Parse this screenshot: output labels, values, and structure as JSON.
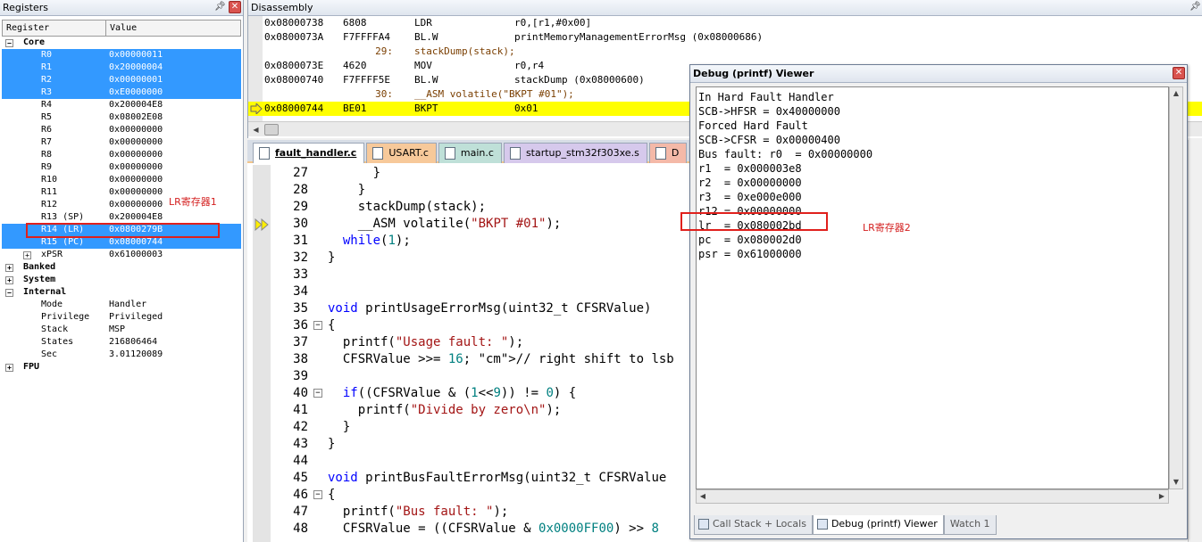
{
  "registers": {
    "title": "Registers",
    "col_register": "Register",
    "col_value": "Value",
    "rows": [
      {
        "name": "Core",
        "value": "",
        "type": "group",
        "expanded": true
      },
      {
        "name": "R0",
        "value": "0x00000011",
        "type": "reg",
        "selected": true
      },
      {
        "name": "R1",
        "value": "0x20000004",
        "type": "reg",
        "selected": true
      },
      {
        "name": "R2",
        "value": "0x00000001",
        "type": "reg",
        "selected": true
      },
      {
        "name": "R3",
        "value": "0xE0000000",
        "type": "reg",
        "selected": true
      },
      {
        "name": "R4",
        "value": "0x200004E8",
        "type": "reg"
      },
      {
        "name": "R5",
        "value": "0x08002E08",
        "type": "reg"
      },
      {
        "name": "R6",
        "value": "0x00000000",
        "type": "reg"
      },
      {
        "name": "R7",
        "value": "0x00000000",
        "type": "reg"
      },
      {
        "name": "R8",
        "value": "0x00000000",
        "type": "reg"
      },
      {
        "name": "R9",
        "value": "0x00000000",
        "type": "reg"
      },
      {
        "name": "R10",
        "value": "0x00000000",
        "type": "reg"
      },
      {
        "name": "R11",
        "value": "0x00000000",
        "type": "reg"
      },
      {
        "name": "R12",
        "value": "0x00000000",
        "type": "reg"
      },
      {
        "name": "R13 (SP)",
        "value": "0x200004E8",
        "type": "reg"
      },
      {
        "name": "R14 (LR)",
        "value": "0x0800279B",
        "type": "reg",
        "selected": true
      },
      {
        "name": "R15 (PC)",
        "value": "0x08000744",
        "type": "reg",
        "selected": true
      },
      {
        "name": "xPSR",
        "value": "0x61000003",
        "type": "reg",
        "expandable": true
      },
      {
        "name": "Banked",
        "value": "",
        "type": "group2"
      },
      {
        "name": "System",
        "value": "",
        "type": "group2"
      },
      {
        "name": "Internal",
        "value": "",
        "type": "group",
        "expanded": true
      },
      {
        "name": "Mode",
        "value": "Handler",
        "type": "reg"
      },
      {
        "name": "Privilege",
        "value": "Privileged",
        "type": "reg"
      },
      {
        "name": "Stack",
        "value": "MSP",
        "type": "reg"
      },
      {
        "name": "States",
        "value": "216806464",
        "type": "reg"
      },
      {
        "name": "Sec",
        "value": "3.01120089",
        "type": "reg"
      },
      {
        "name": "FPU",
        "value": "",
        "type": "group2"
      }
    ],
    "annotation": "LR寄存器1"
  },
  "disassembly": {
    "title": "Disassembly",
    "rows": [
      {
        "kind": "asm",
        "addr": "0x08000738",
        "hex": "6808",
        "mn": "LDR",
        "ops": "r0,[r1,#0x00]"
      },
      {
        "kind": "asm",
        "addr": "0x0800073A",
        "hex": "F7FFFFA4",
        "mn": "BL.W",
        "ops": "printMemoryManagementErrorMsg (0x08000686)"
      },
      {
        "kind": "src",
        "ln": "29:",
        "code": "stackDump(stack);"
      },
      {
        "kind": "asm",
        "addr": "0x0800073E",
        "hex": "4620",
        "mn": "MOV",
        "ops": "r0,r4"
      },
      {
        "kind": "asm",
        "addr": "0x08000740",
        "hex": "F7FFFF5E",
        "mn": "BL.W",
        "ops": "stackDump (0x08000600)"
      },
      {
        "kind": "src",
        "ln": "30:",
        "code": "__ASM volatile(\"BKPT #01\");"
      },
      {
        "kind": "asm",
        "addr": "0x08000744",
        "hex": "BE01",
        "mn": "BKPT",
        "ops": "0x01",
        "current": true
      }
    ]
  },
  "editor": {
    "tabs": [
      "fault_handler.c",
      "USART.c",
      "main.c",
      "startup_stm32f303xe.s",
      "D"
    ],
    "lines": [
      {
        "n": "27",
        "fold": "",
        "html": "      }"
      },
      {
        "n": "28",
        "fold": "",
        "html": "    }"
      },
      {
        "n": "29",
        "fold": "",
        "html": "    stackDump(stack);"
      },
      {
        "n": "30",
        "fold": "",
        "html": "    __ASM volatile(\"BKPT #01\");",
        "current": true
      },
      {
        "n": "31",
        "fold": "",
        "html": "  while(1);"
      },
      {
        "n": "32",
        "fold": "",
        "html": "}"
      },
      {
        "n": "33",
        "fold": "",
        "html": ""
      },
      {
        "n": "34",
        "fold": "",
        "html": ""
      },
      {
        "n": "35",
        "fold": "",
        "html": "void printUsageErrorMsg(uint32_t CFSRValue)"
      },
      {
        "n": "36",
        "fold": "box",
        "html": "{"
      },
      {
        "n": "37",
        "fold": "",
        "html": "  printf(\"Usage fault: \");"
      },
      {
        "n": "38",
        "fold": "",
        "html": "  CFSRValue >>= 16; // right shift to lsb"
      },
      {
        "n": "39",
        "fold": "",
        "html": ""
      },
      {
        "n": "40",
        "fold": "box",
        "html": "  if((CFSRValue & (1<<9)) != 0) {"
      },
      {
        "n": "41",
        "fold": "",
        "html": "    printf(\"Divide by zero\\n\");"
      },
      {
        "n": "42",
        "fold": "",
        "html": "  }"
      },
      {
        "n": "43",
        "fold": "",
        "html": "}"
      },
      {
        "n": "44",
        "fold": "",
        "html": ""
      },
      {
        "n": "45",
        "fold": "",
        "html": "void printBusFaultErrorMsg(uint32_t CFSRValue"
      },
      {
        "n": "46",
        "fold": "box",
        "html": "{"
      },
      {
        "n": "47",
        "fold": "",
        "html": "  printf(\"Bus fault: \");"
      },
      {
        "n": "48",
        "fold": "",
        "html": "  CFSRValue = ((CFSRValue & 0x0000FF00) >> 8"
      }
    ]
  },
  "debug_viewer": {
    "title": "Debug (printf) Viewer",
    "lines": [
      "In Hard Fault Handler",
      "SCB->HFSR = 0x40000000",
      "Forced Hard Fault",
      "SCB->CFSR = 0x00000400",
      "Bus fault: r0  = 0x00000000",
      "r1  = 0x000003e8",
      "r2  = 0x00000000",
      "r3  = 0xe000e000",
      "r12 = 0x00000000",
      "lr  = 0x080002bd",
      "pc  = 0x080002d0",
      "psr = 0x61000000"
    ],
    "annotation": "LR寄存器2",
    "bottom_tabs": [
      "Call Stack + Locals",
      "Debug (printf) Viewer",
      "Watch 1"
    ]
  },
  "colors": {
    "selection": "#3399ff",
    "current_line": "#ffff00",
    "annotation": "#e0201c"
  }
}
